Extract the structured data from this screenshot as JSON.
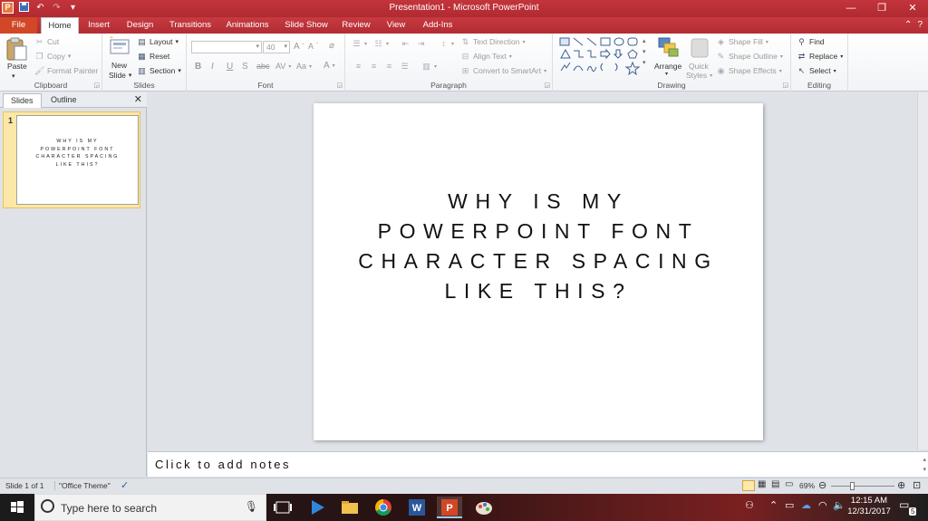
{
  "window": {
    "title": "Presentation1 - Microsoft PowerPoint"
  },
  "tabs": [
    "File",
    "Home",
    "Insert",
    "Design",
    "Transitions",
    "Animations",
    "Slide Show",
    "Review",
    "View",
    "Add-Ins"
  ],
  "clipboard": {
    "group_label": "Clipboard",
    "paste": "Paste",
    "cut": "Cut",
    "copy": "Copy",
    "format_painter": "Format Painter"
  },
  "slides_group": {
    "group_label": "Slides",
    "new_slide_1": "New",
    "new_slide_2": "Slide",
    "layout": "Layout",
    "reset": "Reset",
    "section": "Section"
  },
  "font": {
    "group_label": "Font",
    "font_size": "40"
  },
  "paragraph": {
    "group_label": "Paragraph",
    "text_direction": "Text Direction",
    "align_text": "Align Text",
    "convert_smartart": "Convert to SmartArt"
  },
  "drawing": {
    "group_label": "Drawing",
    "arrange": "Arrange",
    "quick_styles_1": "Quick",
    "quick_styles_2": "Styles",
    "shape_fill": "Shape Fill",
    "shape_outline": "Shape Outline",
    "shape_effects": "Shape Effects"
  },
  "editing": {
    "group_label": "Editing",
    "find": "Find",
    "replace": "Replace",
    "select": "Select"
  },
  "left_pane": {
    "tab_slides": "Slides",
    "tab_outline": "Outline",
    "slide_number": "1",
    "thumb_lines": [
      "WHY IS MY",
      "POWERPOINT FONT",
      "CHARACTER SPACING",
      "LIKE THIS?"
    ]
  },
  "slide": {
    "lines": [
      "WHY IS MY",
      "POWERPOINT FONT",
      "CHARACTER SPACING",
      "LIKE THIS?"
    ]
  },
  "notes": {
    "placeholder": "Click to add notes"
  },
  "status": {
    "slide_info": "Slide 1 of 1",
    "theme": "\"Office Theme\"",
    "zoom": "69%"
  },
  "taskbar": {
    "search_placeholder": "Type here to search",
    "time": "12:15 AM",
    "date": "12/31/2017",
    "notifications": "5"
  },
  "colors": {
    "title_red": "#b92f36",
    "file_orange": "#d24726"
  }
}
